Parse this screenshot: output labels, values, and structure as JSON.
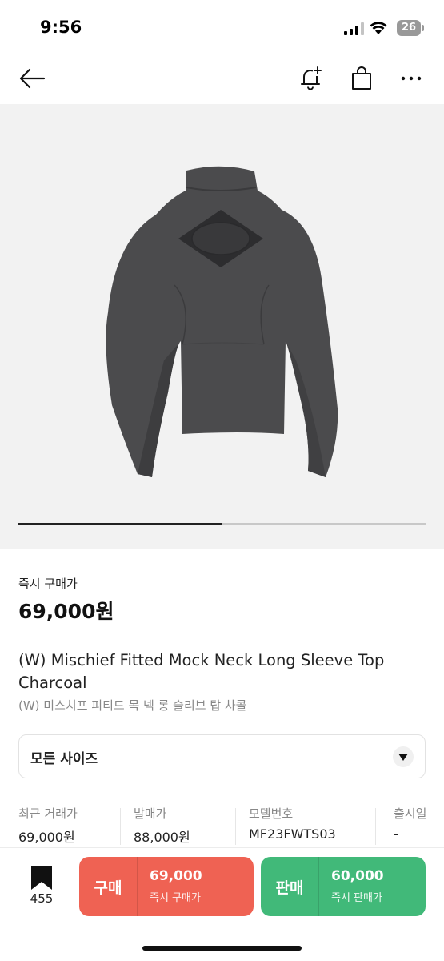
{
  "status": {
    "time": "9:56",
    "battery": "26"
  },
  "nav": {
    "back_icon": "arrow-left-icon",
    "alert_icon": "bell-plus-icon",
    "bag_icon": "shopping-bag-icon",
    "more_icon": "ellipsis-icon"
  },
  "gallery": {
    "progress": 0.5
  },
  "price": {
    "label": "즉시 구매가",
    "value": "69,000원"
  },
  "product": {
    "title_en": "(W) Mischief Fitted Mock Neck Long Sleeve Top Charcoal",
    "title_ko": "(W) 미스치프 피티드 목 넥 롱 슬리브 탑 차콜"
  },
  "size_select": {
    "label": "모든 사이즈"
  },
  "info": [
    {
      "label": "최근 거래가",
      "value": "69,000원"
    },
    {
      "label": "발매가",
      "value": "88,000원"
    },
    {
      "label": "모델번호",
      "value": "MF23FWTS03"
    },
    {
      "label": "출시일",
      "value": "-"
    }
  ],
  "bottom": {
    "wish_count": "455",
    "buy": {
      "label": "구매",
      "price": "69,000",
      "sub": "즉시 구매가"
    },
    "sell": {
      "label": "판매",
      "price": "60,000",
      "sub": "즉시 판매가"
    }
  },
  "colors": {
    "buy": "#ef6253",
    "sell": "#41b979",
    "garment": "#4a4a4c"
  }
}
